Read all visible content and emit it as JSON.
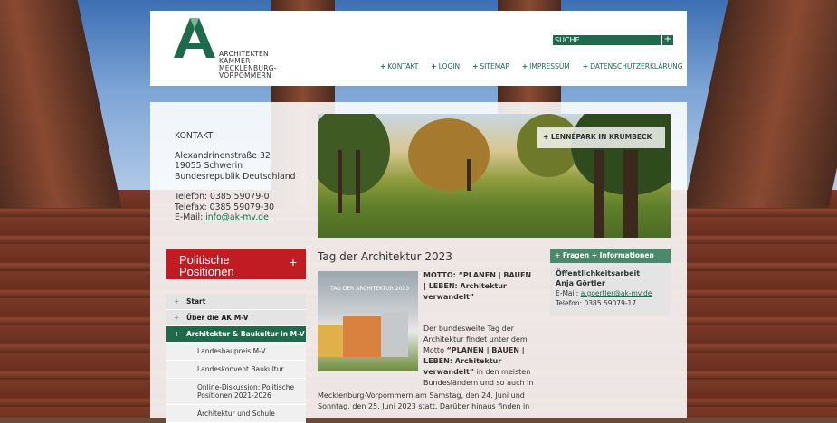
{
  "header": {
    "logo_letter": "A",
    "logo_lines": [
      "ARCHITEKTEN",
      "KAMMER",
      "MECKLENBURG-",
      "VORPOMMERN"
    ],
    "search_label": "SUCHE",
    "search_button": "+",
    "nav": [
      {
        "label": "KONTAKT"
      },
      {
        "label": "LOGIN"
      },
      {
        "label": "SITEMAP"
      },
      {
        "label": "IMPRESSUM"
      },
      {
        "label": "DATENSCHUTZERKLÄRUNG"
      }
    ]
  },
  "contact": {
    "heading": "KONTAKT",
    "street": "Alexandrinenstraße 32",
    "city": "19055 Schwerin",
    "country": "Bundesrepublik Deutschland",
    "phone": "Telefon: 0385 59079-0",
    "fax": "Telefax: 0385 59079-30",
    "email_label": "E-Mail: ",
    "email": "info@ak-mv.de"
  },
  "banner": {
    "tag": "LENNÉPARK IN KRUMBECK"
  },
  "politics_button": {
    "line1": "Politische",
    "line2": "Positionen",
    "plus": "+"
  },
  "sidenav": {
    "items": [
      {
        "label": "Start"
      },
      {
        "label": "Über die AK M-V"
      },
      {
        "label": "Architektur & Baukultur in M-V"
      }
    ],
    "subitems": [
      {
        "label": "Landesbaupreis M-V"
      },
      {
        "label": "Landeskonvent Baukultur"
      },
      {
        "label": "Online-Diskussion: Politische Positionen 2021-2026"
      },
      {
        "label": "Architektur und Schule"
      }
    ]
  },
  "article": {
    "title": "Tag der Architektur 2023",
    "image_label": "TAG DER ARCHITEKTUR 2023",
    "motto": "MOTTO: “PLANEN | BAUEN | LEBEN: Architektur verwandelt”",
    "body1_start": "Der bundesweite Tag der Architektur findet unter dem Motto ",
    "body1_bold": "“PLANEN | BAUEN | LEBEN: Architektur verwandelt”",
    "body1_end": " in den meisten Bundesländern und so auch in",
    "body2": "Mecklenburg-Vorpommern am Samstag, den 24. Juni und Sonntag, den 25. Juni 2023 statt. Darüber hinaus finden in"
  },
  "infobox": {
    "heading": "Fragen + Informationen",
    "role": "Öffentlichkeitsarbeit",
    "name": "Anja Görtler",
    "email_label": "E-Mail: ",
    "email": "a.goertler@ak-mv.de",
    "phone": "Telefon: 0385 59079-17"
  },
  "colors": {
    "brand_green": "#1f6a4d",
    "brand_red": "#c11b24"
  }
}
